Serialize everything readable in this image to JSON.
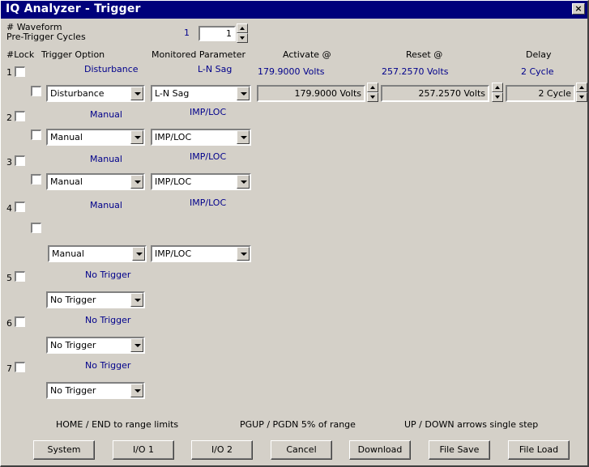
{
  "window": {
    "title": "IQ Analyzer - Trigger",
    "close": "×"
  },
  "header": {
    "waveform_label": "# Waveform",
    "pretrigger_label": "Pre-Trigger Cycles",
    "cycles_display": "1",
    "cycles_value": "1"
  },
  "columns": {
    "lock": "#Lock",
    "option": "Trigger Option",
    "param": "Monitored Parameter",
    "activate": "Activate @",
    "reset": "Reset @",
    "delay": "Delay"
  },
  "triggers": [
    {
      "num": "1",
      "option_text": "Disturbance",
      "param_text": "L-N Sag",
      "activate_text": "179.9000  Volts",
      "reset_text": "257.2570  Volts",
      "delay_text": "2 Cycle",
      "option": "Disturbance",
      "param": "L-N Sag",
      "activate": "179.9000 Volts",
      "reset": "257.2570 Volts",
      "delay": "2 Cycle"
    },
    {
      "num": "2",
      "option_text": "Manual",
      "param_text": "IMP/LOC",
      "option": "Manual",
      "param": "IMP/LOC"
    },
    {
      "num": "3",
      "option_text": "Manual",
      "param_text": "IMP/LOC",
      "option": "Manual",
      "param": "IMP/LOC"
    },
    {
      "num": "4",
      "option_text": "Manual",
      "param_text": "IMP/LOC",
      "option": "Manual",
      "param": "IMP/LOC"
    },
    {
      "num": "5",
      "option_text": "No Trigger",
      "option": "No Trigger"
    },
    {
      "num": "6",
      "option_text": "No Trigger",
      "option": "No Trigger"
    },
    {
      "num": "7",
      "option_text": "No Trigger",
      "option": "No Trigger"
    }
  ],
  "hints": {
    "home_end": "HOME / END to range limits",
    "pgup_pgdn": "PGUP / PGDN 5% of range",
    "arrows": "UP / DOWN arrows single step"
  },
  "buttons": {
    "system": "System",
    "io1": "I/O 1",
    "io2": "I/O 2",
    "cancel": "Cancel",
    "download": "Download",
    "file_save": "File Save",
    "file_load": "File Load"
  }
}
